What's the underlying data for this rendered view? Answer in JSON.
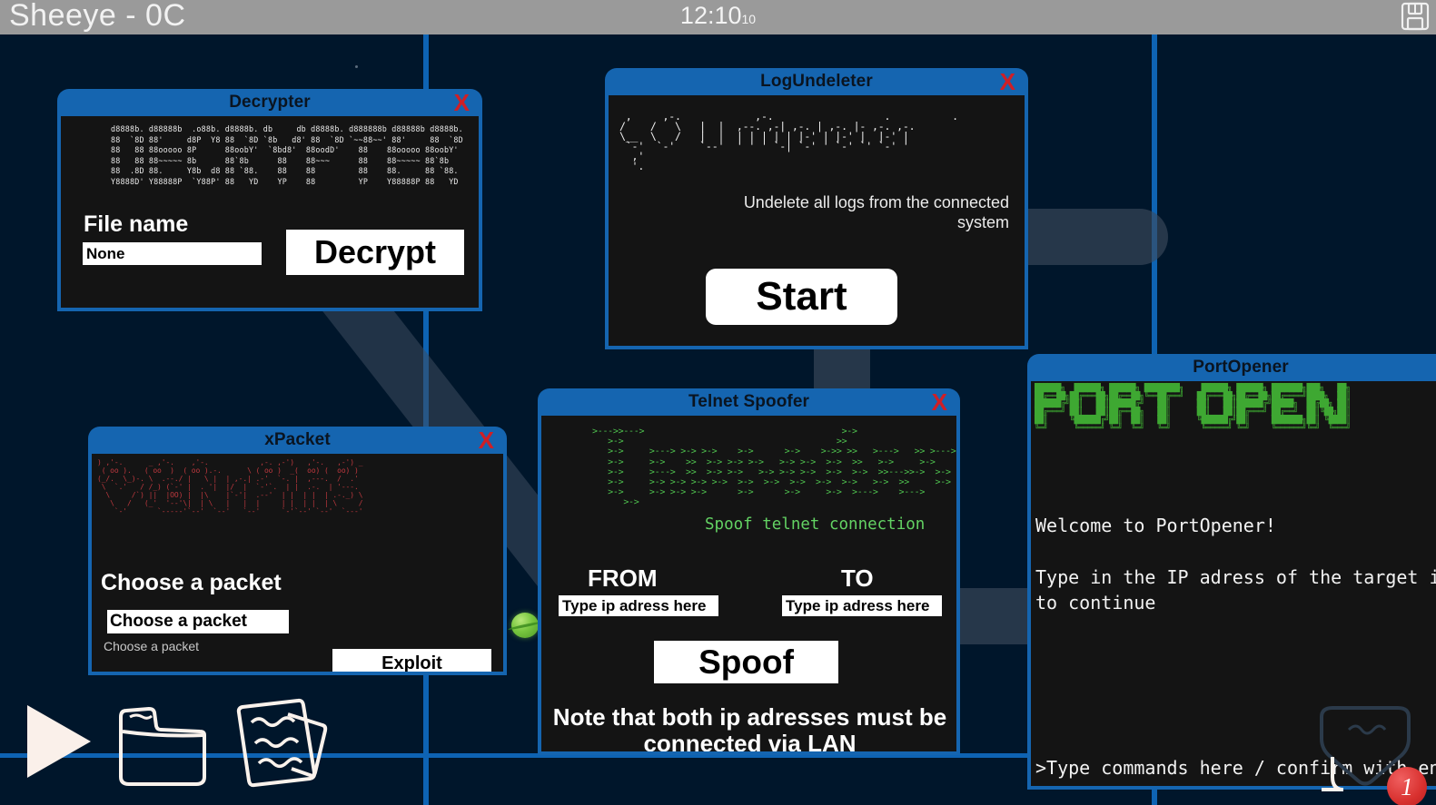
{
  "topbar": {
    "title": "Sheeye - 0C",
    "clock": "12:10",
    "clock_sub": "10",
    "save_icon": "floppy-disk-save-icon"
  },
  "windows": {
    "decrypter": {
      "title": "Decrypter",
      "close": "X",
      "ascii_art": "d8888b. d88888b  .o88b. d8888b. db     db d8888b. d888888b d88888b d8888b.\n88  `8D 88'     d8P  Y8 88  `8D `8b   d8' 88  `8D `~~88~~' 88'     88  `8D\n88   88 88ooooo 8P      88oobY'  `8bd8'  88oodD'    88    88ooooo 88oobY'\n88   88 88~~~~~ 8b      88`8b      88    88~~~      88    88~~~~~ 88`8b\n88  .8D 88.     Y8b  d8 88 `88.    88    88         88    88.     88 `88.\nY8888D' Y88888P  `Y88P' 88   YD    YP    88         YP    Y88888P 88   YD",
      "file_label": "File name",
      "file_value": "None",
      "decrypt_button": "Decrypt"
    },
    "logundeleter": {
      "title": "LogUndeleter",
      "close": "X",
      "ascii_art": " ,     ,-.            ,-.                  .          .\n/    /   \\   |  |  ,--. ,-| ,-. | ,-. |- ,-. ,-.\n\\__  \\   /   |  |  | | | | | |-' | |-' |  |-' |\n `-'  `-'    `--'  ' ' ' `-| `-' ' `-' `' `-' '\n  ,'                                              \n  '.                                              ",
      "description": "Undelete all logs from the connected system",
      "start_button": "Start"
    },
    "xpacket": {
      "title": "xPacket",
      "close": "X",
      "ascii_art": ") ,'-.      _ ,'-.    ,'-.            ,-. ,-')   ,'-.   ,-') _\n ( oo ).   ( oo  )  ( oo ).-.      \\ ( oo )  _(  oo) (  oo) )\n(_/.  \\_)-. \\  .--./ |   \\ |  | ,-.| .-'  `-. |  ,---.  /  .'\n \\  `.'   / /_) (`-' |  . '|  |/  |  `-'`.  | |  .-.  | '---.\n  \\     /`) ||  |OO) |  |\\    |`-'|  .--'  | |  | |  | .-._) \\\n   \\   /   (_'  '--'\\|  | \\   |   |  |     | |  | |  | \\     /\n    `-'       `-----'`--'  `--'   `--'     `-'`--' `--'  `---'",
      "choose_label": "Choose a packet",
      "select_value": "Choose a packet",
      "hint": "Choose a packet",
      "exploit_button": "Exploit"
    },
    "telnet": {
      "title": "Telnet Spoofer",
      "close": "X",
      "ascii_art": ">--->>--->                                      >->\n   >->                                         >>\n   >->     >---> >-> >->    >->      >->    >->> >>   >--->   >> >--->\n   >->     >->    >>  >-> >-> >->   >-> >->  >->  >>   >->     >->\n   >->     >--->  >>  >-> >->   >-> >-> >->  >->  >->  >>--->>->  >->\n   >->     >-> >-> >-> >->  >->  >->  >->  >->  >->   >->  >>     >->\n   >->     >-> >-> >->      >->      >->     >->  >--->    >--->\n      >->",
      "subtitle": "Spoof telnet connection",
      "from_label": "FROM",
      "to_label": "TO",
      "from_value": "Type ip adress here",
      "to_value": "Type ip adress here",
      "spoof_button": "Spoof",
      "note": "Note that both ip adresses must be connected via LAN"
    },
    "portopener": {
      "title": "PortOpener",
      "ascii_art": "██████╗  ██████╗ ██████╗ ████████╗    ██████╗ ██████╗ ███████╗███╗   ██╗\n██╔══██╗██╔═══██╗██╔══██╗╚══██╔══╝   ██╔═══██╗██╔══██╗██╔════╝████╗  ██║\n██████╔╝██║   ██║██████╔╝   ██║      ██║   ██║██████╔╝█████╗  ██╔██╗ ██║\n██╔═══╝ ██║   ██║██╔══██╗   ██║      ██║   ██║██╔═══╝ ██╔══╝  ██║╚██╗██║\n██║     ╚██████╔╝██║  ██║   ██║      ╚██████╔╝██║     ███████╗██║ ╚████║\n╚═╝      ╚═════╝ ╚═╝  ╚═╝   ╚═╝       ╚═════╝ ╚═╝     ╚══════╝╚═╝  ╚═══╝",
      "console_text": "Welcome to PortOpener!\n\nType in the IP adress of the target i\nto continue",
      "prompt_text": ">Type commands here / confirm with enter"
    }
  },
  "taskbar": {
    "play_icon": "play-triangle-icon",
    "folder_icon": "folder-icon",
    "notes_icon": "notes-documents-icon"
  },
  "mail": {
    "icon": "envelope-mail-icon",
    "badge_count": "1"
  },
  "colors": {
    "background": "#00162b",
    "window_frame": "#1565b0",
    "window_body": "#141414",
    "topbar": "#9a9a9a",
    "close_red": "#cf1f26",
    "telnet_green": "#4ec14e",
    "portopener_green": "#3ea832",
    "xpacket_red": "#c0393f",
    "badge_red": "#d8302e",
    "path_grey": "#3d4c5e"
  }
}
